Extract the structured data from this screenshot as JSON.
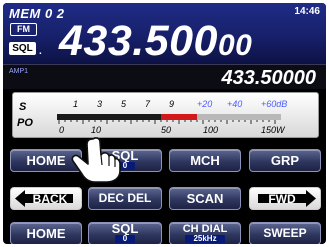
{
  "header": {
    "memory": "MEM 0 2",
    "clock": "14:46",
    "mode_badge": "FM",
    "sql_badge": "SQL",
    "sql_dot": ".",
    "main_freq": "433.500",
    "main_freq_small": "00"
  },
  "sub": {
    "amp_label": "AMP1",
    "freq": "433.50000"
  },
  "meter": {
    "s_label": "S",
    "po_label": "PO",
    "s_scale": [
      "1",
      "3",
      "5",
      "7",
      "9",
      "+20",
      "+40",
      "+60dB"
    ],
    "po_scale": [
      "0",
      "10",
      "50",
      "100",
      "150W"
    ]
  },
  "buttons": {
    "row1": [
      {
        "label": "HOME"
      },
      {
        "label": "SQL",
        "value": "0"
      },
      {
        "label": "MCH"
      },
      {
        "label": "GRP"
      }
    ],
    "row2": [
      {
        "label": "BACK"
      },
      {
        "label": "DEC DEL"
      },
      {
        "label": "SCAN"
      },
      {
        "label": "FWD"
      }
    ],
    "row3": [
      {
        "label": "HOME"
      },
      {
        "label": "SQL",
        "value": "0"
      },
      {
        "label": "CH DIAL",
        "value": "25kHz"
      },
      {
        "label": "SWEEP"
      }
    ]
  },
  "colors": {
    "header_bg": "#1f2c86",
    "meter_red": "#d21818",
    "button_bg": "#2f3760"
  }
}
